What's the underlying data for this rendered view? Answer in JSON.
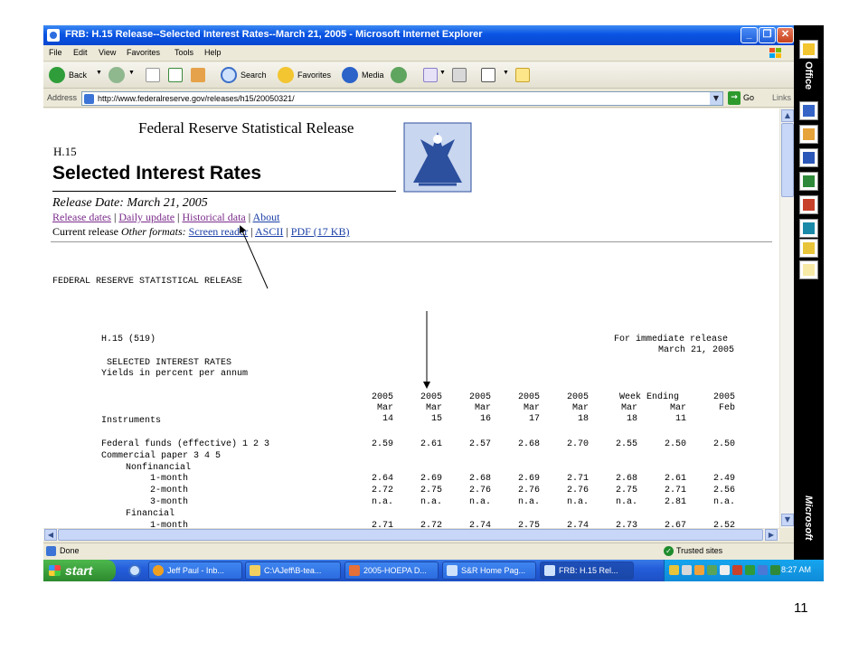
{
  "window": {
    "title": "FRB: H.15 Release--Selected Interest Rates--March 21, 2005 - Microsoft Internet Explorer"
  },
  "menu": [
    "File",
    "Edit",
    "View",
    "Favorites",
    "Tools",
    "Help"
  ],
  "toolbar": {
    "back": "Back",
    "search": "Search",
    "favorites": "Favorites",
    "media": "Media"
  },
  "address": {
    "label": "Address",
    "url": "http://www.federalreserve.gov/releases/h15/20050321/",
    "go": "Go",
    "links": "Links"
  },
  "page": {
    "header": "Federal Reserve Statistical Release",
    "code": "H.15",
    "title": "Selected Interest Rates",
    "release_date": "Release Date: March 21, 2005",
    "links": [
      "Release dates",
      "Daily update",
      "Historical data",
      "About"
    ],
    "current_release": "Current release",
    "other_formats": "Other formats:",
    "formats": [
      "Screen reader",
      "ASCII",
      "PDF (17 KB)"
    ]
  },
  "report": {
    "banner": "FEDERAL RESERVE STATISTICAL RELEASE",
    "code": "H.15 (519)",
    "release_note": "For immediate release",
    "release_day": "March 21, 2005",
    "heading": "SELECTED INTEREST RATES",
    "subheading": "Yields in percent per annum",
    "week_ending": "Week Ending",
    "instruments_label": "Instruments",
    "columns": [
      {
        "year": "2005",
        "month": "Mar",
        "day": "14"
      },
      {
        "year": "2005",
        "month": "Mar",
        "day": "15"
      },
      {
        "year": "2005",
        "month": "Mar",
        "day": "16"
      },
      {
        "year": "2005",
        "month": "Mar",
        "day": "17"
      },
      {
        "year": "2005",
        "month": "Mar",
        "day": "18"
      },
      {
        "year": "",
        "month": "Mar",
        "day": "18"
      },
      {
        "year": "",
        "month": "Mar",
        "day": "11"
      },
      {
        "year": "2005",
        "month": "Feb",
        "day": ""
      }
    ],
    "rows": [
      {
        "label": "Federal funds (effective) 1 2 3",
        "indent": 0,
        "values": [
          "2.59",
          "2.61",
          "2.57",
          "2.68",
          "2.70",
          "2.55",
          "2.50",
          "2.50"
        ]
      },
      {
        "label": "Commercial paper 3 4 5",
        "indent": 0,
        "values": []
      },
      {
        "label": "Nonfinancial",
        "indent": 1,
        "values": []
      },
      {
        "label": "1-month",
        "indent": 2,
        "values": [
          "2.64",
          "2.69",
          "2.68",
          "2.69",
          "2.71",
          "2.68",
          "2.61",
          "2.49"
        ]
      },
      {
        "label": "2-month",
        "indent": 2,
        "values": [
          "2.72",
          "2.75",
          "2.76",
          "2.76",
          "2.76",
          "2.75",
          "2.71",
          "2.56"
        ]
      },
      {
        "label": "3-month",
        "indent": 2,
        "values": [
          "n.a.",
          "n.a.",
          "n.a.",
          "n.a.",
          "n.a.",
          "n.a.",
          "2.81",
          "n.a."
        ]
      },
      {
        "label": "Financial",
        "indent": 1,
        "values": []
      },
      {
        "label": "1-month",
        "indent": 2,
        "values": [
          "2.71",
          "2.72",
          "2.74",
          "2.75",
          "2.74",
          "2.73",
          "2.67",
          "2.52"
        ]
      }
    ]
  },
  "status": {
    "text": "Done",
    "zone": "Trusted sites"
  },
  "taskbar": {
    "start": "start",
    "tasks": [
      "Jeff Paul - Inb...",
      "C:\\AJeff\\B-tea...",
      "2005-HOEPA D...",
      "S&R Home Pag...",
      "FRB: H.15 Rel..."
    ],
    "clock": "8:27 AM"
  },
  "officebar": {
    "office_label": "Office",
    "microsoft_label": "Microsoft"
  },
  "slide_number": "11",
  "colors": {
    "titlebar": "#0a54e3",
    "link": "#1a3fa6",
    "visited_link": "#7a2b8a",
    "taskbar": "#245edb",
    "start": "#2d8a2d"
  }
}
